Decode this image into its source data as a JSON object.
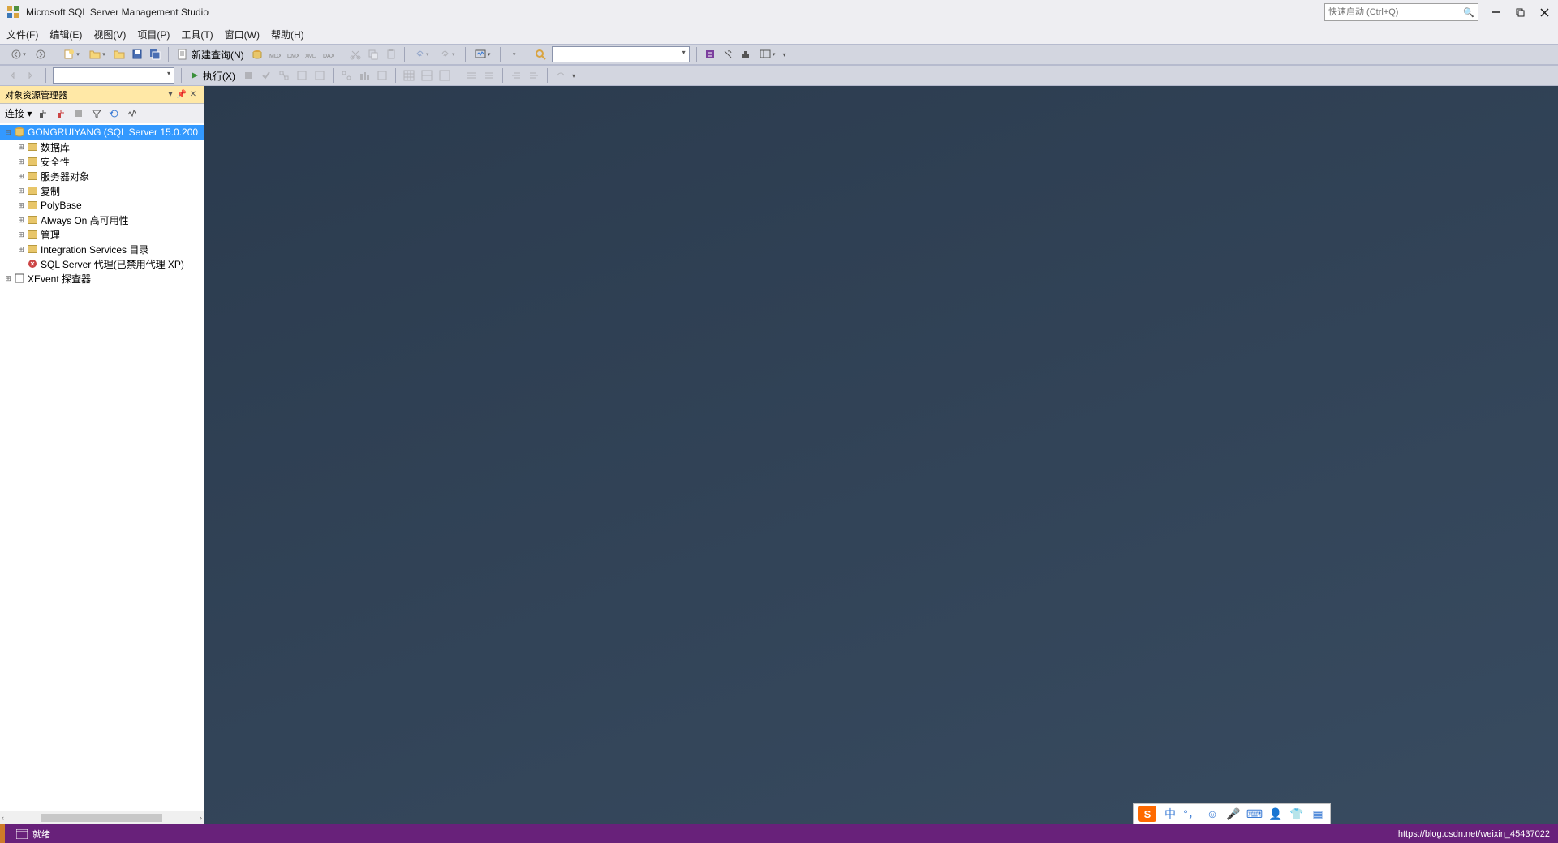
{
  "app": {
    "title": "Microsoft SQL Server Management Studio",
    "quick_launch_placeholder": "快速启动 (Ctrl+Q)"
  },
  "menu": {
    "file": "文件(F)",
    "edit": "编辑(E)",
    "view": "视图(V)",
    "project": "项目(P)",
    "tools": "工具(T)",
    "window": "窗口(W)",
    "help": "帮助(H)"
  },
  "toolbar": {
    "new_query": "新建查询(N)",
    "execute": "执行(X)"
  },
  "object_explorer": {
    "title": "对象资源管理器",
    "connect_label": "连接 ▾",
    "root": "GONGRUIYANG (SQL Server 15.0.200",
    "nodes": {
      "databases": "数据库",
      "security": "安全性",
      "server_objects": "服务器对象",
      "replication": "复制",
      "polybase": "PolyBase",
      "always_on": "Always On 高可用性",
      "management": "管理",
      "integration": "Integration Services 目录",
      "sql_agent": "SQL Server 代理(已禁用代理 XP)",
      "xevent": "XEvent 探查器"
    }
  },
  "status": {
    "ready": "就绪",
    "watermark": "https://blog.csdn.net/weixin_45437022"
  },
  "ime": {
    "logo": "S",
    "zhong": "中"
  }
}
